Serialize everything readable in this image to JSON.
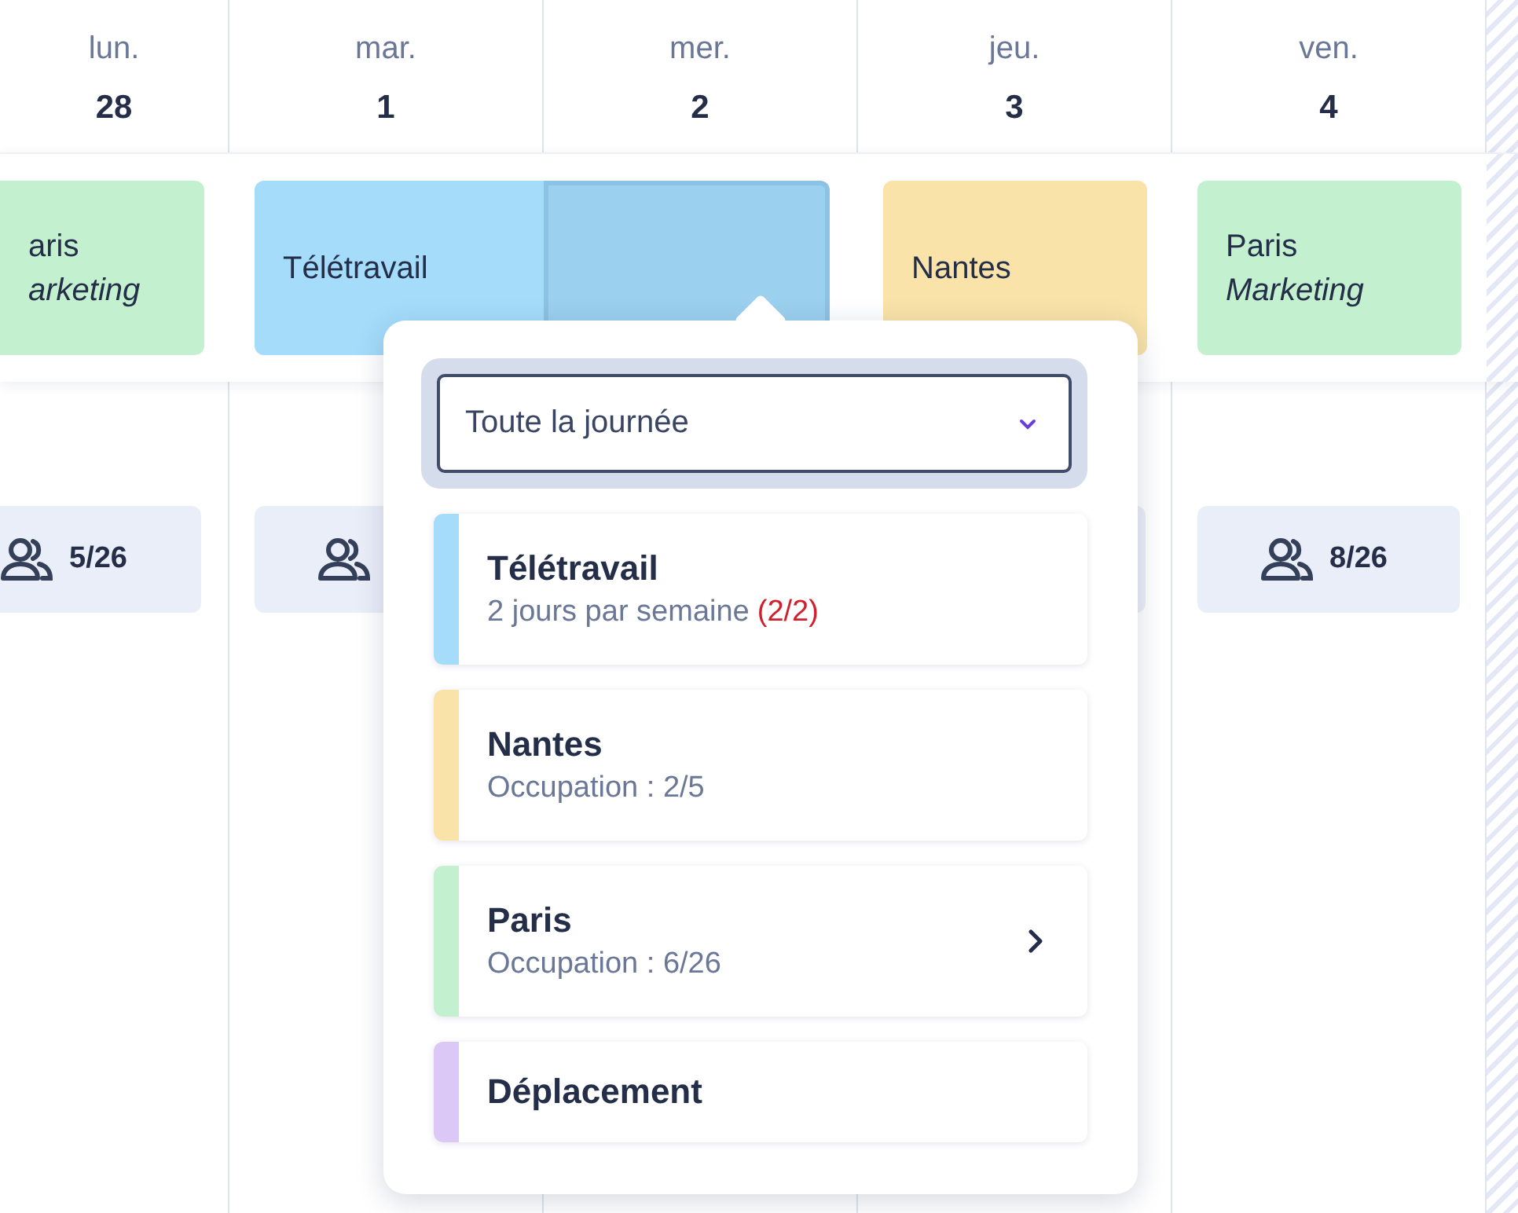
{
  "days": [
    {
      "weekday": "lun.",
      "date": "28"
    },
    {
      "weekday": "mar.",
      "date": "1"
    },
    {
      "weekday": "mer.",
      "date": "2"
    },
    {
      "weekday": "jeu.",
      "date": "3"
    },
    {
      "weekday": "ven.",
      "date": "4"
    }
  ],
  "events": [
    {
      "kind": "single",
      "title": "aris",
      "subtitle": "arketing",
      "color": "#c3f0cf",
      "selected": false
    },
    {
      "kind": "start",
      "title": "Télétravail",
      "color": "#a5dcfa",
      "selected": false
    },
    {
      "kind": "end",
      "color": "#9bd0ee",
      "selected": true
    },
    {
      "kind": "single",
      "title": "Nantes",
      "color": "#f9e3a8",
      "selected": false
    },
    {
      "kind": "single",
      "title": "Paris",
      "subtitle": "Marketing",
      "color": "#c3f0cf",
      "selected": false
    }
  ],
  "occupancy": [
    {
      "kind": "chip",
      "count": "5/26"
    },
    {
      "kind": "chip"
    },
    {
      "kind": "covered"
    },
    {
      "kind": "chip"
    },
    {
      "kind": "chip",
      "count": "8/26"
    }
  ],
  "popover": {
    "select": {
      "value": "Toute la journée"
    },
    "options": [
      {
        "title": "Télétravail",
        "subtitle": "2 jours par semaine",
        "quota": "(2/2)",
        "color": "#a5dcfa",
        "has_submenu": false
      },
      {
        "title": "Nantes",
        "subtitle": "Occupation : 2/5",
        "color": "#f9e3a8",
        "has_submenu": false
      },
      {
        "title": "Paris",
        "subtitle": "Occupation : 6/26",
        "color": "#c3f0cf",
        "has_submenu": true
      },
      {
        "title": "Déplacement",
        "color": "#dcc8f6",
        "has_submenu": false
      }
    ]
  }
}
